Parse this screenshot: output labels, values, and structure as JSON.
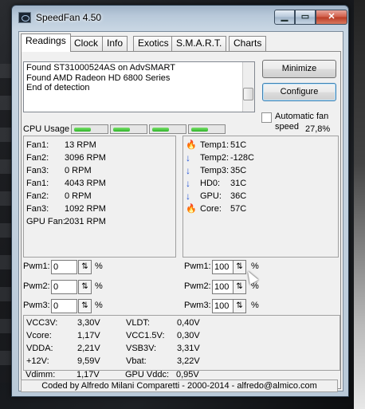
{
  "window": {
    "title": "SpeedFan 4.50"
  },
  "tabs": [
    "Readings",
    "Clock",
    "Info",
    "Exotics",
    "S.M.A.R.T.",
    "Charts"
  ],
  "log": {
    "lines": [
      "Found ST31000524AS on AdvSMART",
      "Found AMD Radeon HD 6800 Series",
      "End of detection"
    ]
  },
  "buttons": {
    "minimize": "Minimize",
    "configure": "Configure"
  },
  "checkbox": {
    "label": "Automatic fan speed",
    "checked": false
  },
  "cpu": {
    "label": "CPU Usage",
    "bars": [
      0.55,
      0.55,
      0.55,
      0.55
    ],
    "value": "27,8%"
  },
  "fans": [
    {
      "name": "Fan1:",
      "value": "13 RPM"
    },
    {
      "name": "Fan2:",
      "value": "3096 RPM"
    },
    {
      "name": "Fan3:",
      "value": "0 RPM"
    },
    {
      "name": "Fan1:",
      "value": "4043 RPM"
    },
    {
      "name": "Fan2:",
      "value": "0 RPM"
    },
    {
      "name": "Fan3:",
      "value": "1092 RPM"
    },
    {
      "name": "GPU Fan:",
      "value": "2031 RPM"
    }
  ],
  "temps": [
    {
      "name": "Temp1:",
      "value": "51C",
      "icon": "flame-icon"
    },
    {
      "name": "Temp2:",
      "value": "-128C",
      "icon": "arrow-down-icon"
    },
    {
      "name": "Temp3:",
      "value": "35C",
      "icon": "arrow-down-icon"
    },
    {
      "name": "HD0:",
      "value": "31C",
      "icon": "arrow-down-icon"
    },
    {
      "name": "GPU:",
      "value": "36C",
      "icon": "arrow-down-icon"
    },
    {
      "name": "Core:",
      "value": "57C",
      "icon": "flame-icon"
    }
  ],
  "pwm_left": [
    {
      "label": "Pwm1:",
      "value": "0"
    },
    {
      "label": "Pwm2:",
      "value": "0"
    },
    {
      "label": "Pwm3:",
      "value": "0"
    }
  ],
  "pwm_right": [
    {
      "label": "Pwm1:",
      "value": "100"
    },
    {
      "label": "Pwm2:",
      "value": "100"
    },
    {
      "label": "Pwm3:",
      "value": "100"
    }
  ],
  "pct_symbol": "%",
  "voltages_left": [
    {
      "name": "VCC3V:",
      "value": "3,30V"
    },
    {
      "name": "Vcore:",
      "value": "1,17V"
    },
    {
      "name": "VDDA:",
      "value": "2,21V"
    },
    {
      "name": "+12V:",
      "value": "9,59V"
    },
    {
      "name": "Vdimm:",
      "value": "1,17V"
    }
  ],
  "voltages_right": [
    {
      "name": "VLDT:",
      "value": "0,40V"
    },
    {
      "name": "VCC1.5V:",
      "value": "0,30V"
    },
    {
      "name": "VSB3V:",
      "value": "3,31V"
    },
    {
      "name": "Vbat:",
      "value": "3,22V"
    },
    {
      "name": "GPU Vddc:",
      "value": "0,95V"
    }
  ],
  "credits": "Coded by Alfredo Milani Comparetti - 2000-2014 - alfredo@almico.com"
}
